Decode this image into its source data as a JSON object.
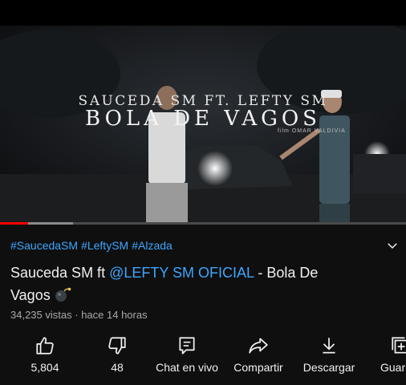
{
  "video": {
    "overlay_title_line1": "SAUCEDA SM FT. LEFTY SM",
    "overlay_title_line2": "BOLA DE VAGOS",
    "overlay_credit": "film OMAR VALDIVIA",
    "progress_percent": 7,
    "buffered_percent": 18
  },
  "hashtags": [
    "#SaucedaSM",
    "#LeftySM",
    "#Alzada"
  ],
  "title": {
    "prefix": "Sauceda SM ft ",
    "mention": "@LEFTY SM OFICIAL",
    "suffix": " - Bola De Vagos"
  },
  "meta": {
    "views": "34,235 vistas",
    "separator": "·",
    "age": "hace 14 horas"
  },
  "actions": {
    "like_count": "5,804",
    "dislike_count": "48",
    "chat_label": "Chat en vivo",
    "share_label": "Compartir",
    "download_label": "Descargar",
    "save_label": "Guar"
  },
  "colors": {
    "background": "#0f0f0f",
    "link": "#3ea6ff",
    "progress": "#ff0000",
    "muted": "#aaaaaa"
  },
  "icons": [
    "thumbs-up-icon",
    "thumbs-down-icon",
    "chat-icon",
    "share-icon",
    "download-icon",
    "save-icon",
    "chevron-down-icon",
    "bomb-icon"
  ]
}
